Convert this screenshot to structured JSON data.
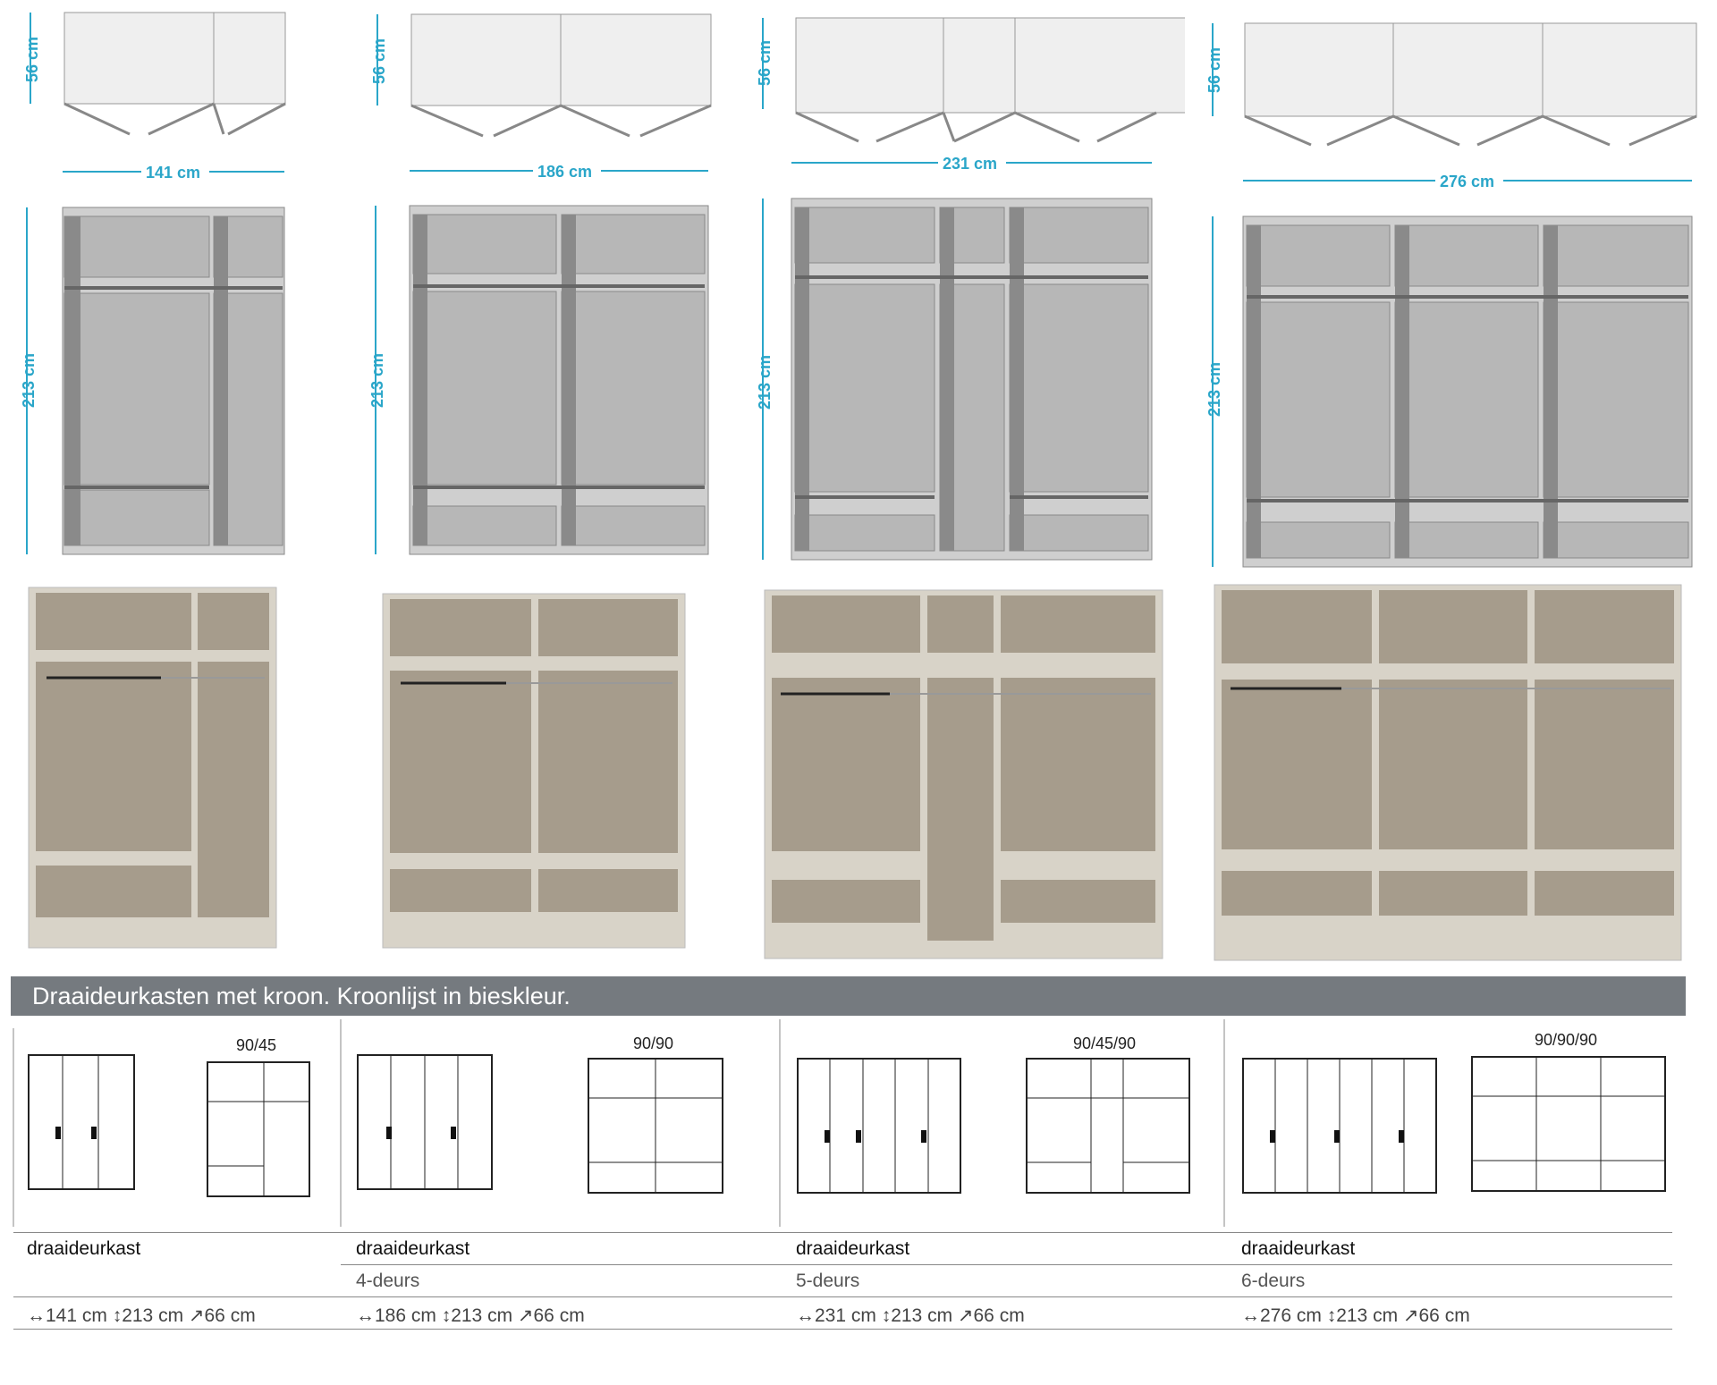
{
  "banner": {
    "text": "Draaideurkasten met kroon. Kroonlijst in bieskleur."
  },
  "cabinets": [
    {
      "depth": "56 cm",
      "width": "141 cm",
      "height": "213 cm",
      "config": "90/45",
      "spec": {
        "title": "draaideurkast",
        "subtitle": "",
        "dims": "↔141 cm ↕213 cm ↗66 cm"
      }
    },
    {
      "depth": "56 cm",
      "width": "186 cm",
      "height": "213 cm",
      "config": "90/90",
      "spec": {
        "title": "draaideurkast",
        "subtitle": "4-deurs",
        "dims": "↔186 cm ↕213 cm ↗66 cm"
      }
    },
    {
      "depth": "56 cm",
      "width": "231 cm",
      "height": "213 cm",
      "config": "90/45/90",
      "spec": {
        "title": "draaideurkast",
        "subtitle": "5-deurs",
        "dims": "↔231 cm ↕213 cm ↗66 cm"
      }
    },
    {
      "depth": "56 cm",
      "width": "276 cm",
      "height": "213 cm",
      "config": "90/90/90",
      "spec": {
        "title": "draaideurkast",
        "subtitle": "6-deurs",
        "dims": "↔276 cm ↕213 cm ↗66 cm"
      }
    }
  ],
  "colors": {
    "dimension": "#2aa6c9",
    "interior_gray": "#b7b7b7",
    "panel_dark": "#888888",
    "photo_interior": "#a69c8c",
    "photo_panel": "#d8d3c8",
    "banner": "#757a7f"
  }
}
